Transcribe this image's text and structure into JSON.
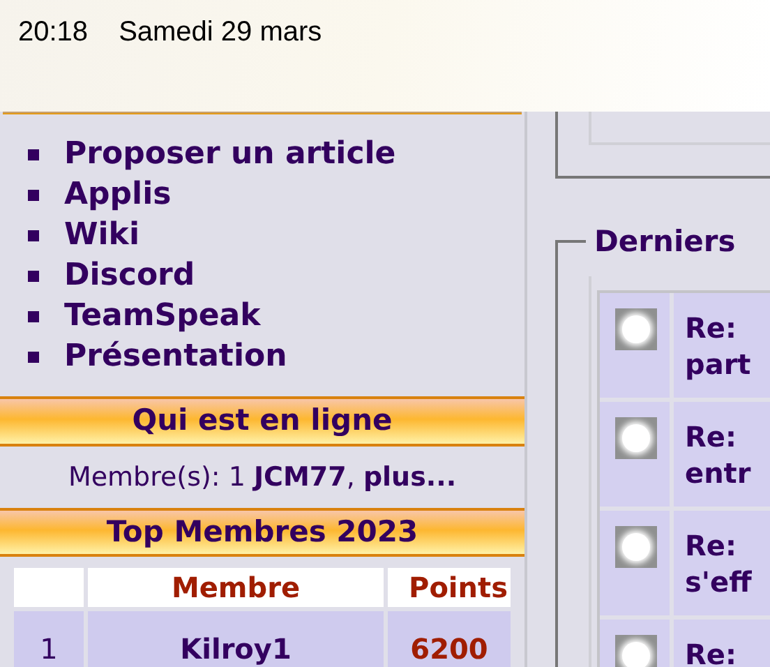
{
  "status_bar": {
    "time": "20:18",
    "date": "Samedi 29 mars"
  },
  "nav_links": [
    "Proposer un article",
    "Applis",
    "Wiki",
    "Discord",
    "TeamSpeak",
    "Présentation"
  ],
  "online": {
    "title": "Qui est en ligne",
    "text": "Membre(s): 1 **JCM77**, **plus...**"
  },
  "top_members": {
    "title": "Top Membres 2023",
    "columns": [
      "Membre",
      "Points"
    ],
    "rows": [
      {
        "rank": "1",
        "member": "Kilroy1",
        "points": "6200"
      }
    ]
  },
  "latest": {
    "title": "Derniers",
    "posts": [
      {
        "line1": "Re:",
        "line2": "part"
      },
      {
        "line1": "Re:",
        "line2": "entr"
      },
      {
        "line1": "Re:",
        "line2": "s'eff"
      },
      {
        "line1": "Re:"
      }
    ]
  }
}
